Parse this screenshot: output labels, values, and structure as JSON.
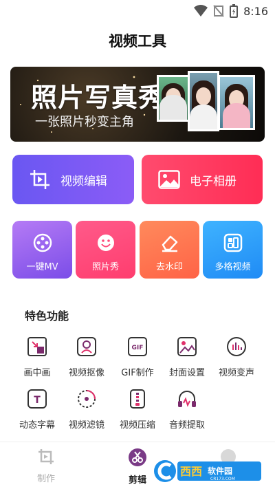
{
  "status_bar": {
    "time": "8:16",
    "icons": [
      "wifi-icon",
      "signal-off-icon",
      "battery-charging-icon"
    ]
  },
  "header": {
    "title": "视频工具"
  },
  "banner": {
    "title": "照片写真秀",
    "subtitle": "一张照片秒变主角"
  },
  "primary_actions": [
    {
      "label": "视频编辑",
      "icon": "crop-play-icon",
      "color": "#7b5cf5"
    },
    {
      "label": "电子相册",
      "icon": "image-icon",
      "color": "#ff3a60"
    }
  ],
  "tiles": [
    {
      "label": "一键MV",
      "icon": "film-reel-icon",
      "color": "#9a63ef"
    },
    {
      "label": "照片秀",
      "icon": "smile-icon",
      "color": "#ff4a7a"
    },
    {
      "label": "去水印",
      "icon": "eraser-icon",
      "color": "#ff7450"
    },
    {
      "label": "多格视频",
      "icon": "grid-icon",
      "color": "#2e9ef8"
    }
  ],
  "features": {
    "title": "特色功能",
    "items": [
      {
        "label": "画中画",
        "icon": "pip-icon"
      },
      {
        "label": "视频抠像",
        "icon": "cutout-icon"
      },
      {
        "label": "GIF制作",
        "icon": "gif-icon"
      },
      {
        "label": "封面设置",
        "icon": "cover-icon"
      },
      {
        "label": "视频变声",
        "icon": "voice-change-icon"
      },
      {
        "label": "动态字幕",
        "icon": "subtitle-icon"
      },
      {
        "label": "视频滤镜",
        "icon": "filter-icon"
      },
      {
        "label": "视频压缩",
        "icon": "compress-icon"
      },
      {
        "label": "音频提取",
        "icon": "headphones-icon"
      }
    ]
  },
  "tab_bar": {
    "tabs": [
      {
        "label": "制作",
        "icon": "make-icon",
        "active": false
      },
      {
        "label": "剪辑",
        "icon": "scissors-icon",
        "active": true
      }
    ]
  },
  "watermark": {
    "text": "西西软件园",
    "site": "CR173.COM"
  },
  "colors": {
    "accent_purple": "#6a57f2",
    "accent_red": "#ff2d55",
    "feature_icon": "#7b2a6c"
  }
}
